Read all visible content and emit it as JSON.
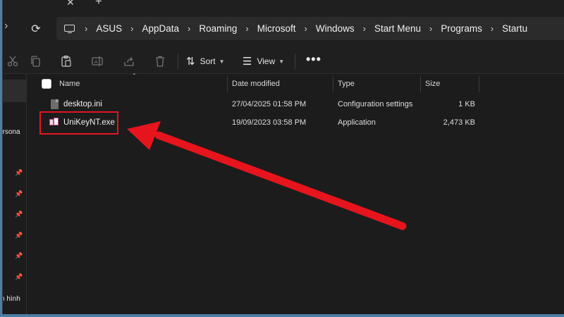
{
  "titlebar": {
    "close_icon": "close-icon",
    "new_tab_icon": "plus-icon"
  },
  "address": {
    "breadcrumbs": [
      "ASUS",
      "AppData",
      "Roaming",
      "Microsoft",
      "Windows",
      "Start Menu",
      "Programs",
      "Startu"
    ]
  },
  "toolbar": {
    "sort_label": "Sort",
    "view_label": "View",
    "more_label": "•••"
  },
  "sidebar": {
    "partial_label_1": "ersona",
    "partial_label_2": "n hình"
  },
  "columns": {
    "name": "Name",
    "date": "Date modified",
    "type": "Type",
    "size": "Size"
  },
  "files": [
    {
      "name": "desktop.ini",
      "date": "27/04/2025 01:58 PM",
      "type": "Configuration settings",
      "size": "1 KB"
    },
    {
      "name": "UniKeyNT.exe",
      "date": "19/09/2023 03:58 PM",
      "type": "Application",
      "size": "2,473 KB"
    }
  ],
  "colors": {
    "annotation": "#e5141d",
    "window_bg": "#1c1c1c",
    "desktop_bg": "#4c7fa3"
  }
}
